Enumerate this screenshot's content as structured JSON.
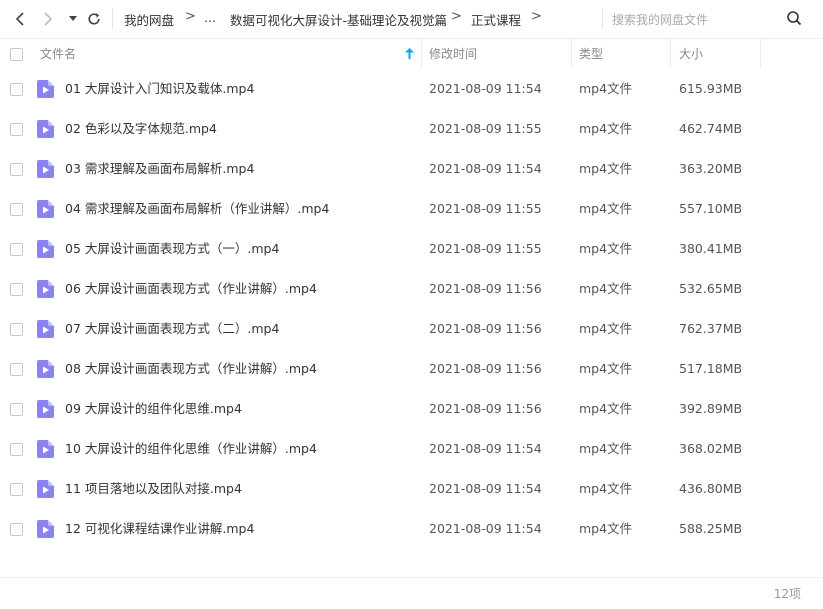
{
  "nav": {
    "breadcrumbs": [
      "我的网盘",
      "...",
      "数据可视化大屏设计-基础理论及视觉篇",
      "正式课程"
    ],
    "separator": ">"
  },
  "search": {
    "placeholder": "搜索我的网盘文件"
  },
  "columns": {
    "name": "文件名",
    "modified": "修改时间",
    "type": "类型",
    "size": "大小"
  },
  "files": [
    {
      "name": "01 大屏设计入门知识及载体.mp4",
      "modified": "2021-08-09 11:54",
      "type": "mp4文件",
      "size": "615.93MB"
    },
    {
      "name": "02 色彩以及字体规范.mp4",
      "modified": "2021-08-09 11:55",
      "type": "mp4文件",
      "size": "462.74MB"
    },
    {
      "name": "03 需求理解及画面布局解析.mp4",
      "modified": "2021-08-09 11:54",
      "type": "mp4文件",
      "size": "363.20MB"
    },
    {
      "name": "04 需求理解及画面布局解析（作业讲解）.mp4",
      "modified": "2021-08-09 11:55",
      "type": "mp4文件",
      "size": "557.10MB"
    },
    {
      "name": "05 大屏设计画面表现方式（一）.mp4",
      "modified": "2021-08-09 11:55",
      "type": "mp4文件",
      "size": "380.41MB"
    },
    {
      "name": "06 大屏设计画面表现方式（作业讲解）.mp4",
      "modified": "2021-08-09 11:56",
      "type": "mp4文件",
      "size": "532.65MB"
    },
    {
      "name": "07 大屏设计画面表现方式（二）.mp4",
      "modified": "2021-08-09 11:56",
      "type": "mp4文件",
      "size": "762.37MB"
    },
    {
      "name": "08 大屏设计画面表现方式（作业讲解）.mp4",
      "modified": "2021-08-09 11:56",
      "type": "mp4文件",
      "size": "517.18MB"
    },
    {
      "name": "09 大屏设计的组件化思维.mp4",
      "modified": "2021-08-09 11:56",
      "type": "mp4文件",
      "size": "392.89MB"
    },
    {
      "name": "10 大屏设计的组件化思维（作业讲解）.mp4",
      "modified": "2021-08-09 11:54",
      "type": "mp4文件",
      "size": "368.02MB"
    },
    {
      "name": "11 项目落地以及团队对接.mp4",
      "modified": "2021-08-09 11:54",
      "type": "mp4文件",
      "size": "436.80MB"
    },
    {
      "name": "12 可视化课程结课作业讲解.mp4",
      "modified": "2021-08-09 11:54",
      "type": "mp4文件",
      "size": "588.25MB"
    }
  ],
  "footer": {
    "count": "12项"
  },
  "colors": {
    "accent": "#06a7ff",
    "video_icon": "#8b83f0",
    "divider": "#ececec"
  }
}
